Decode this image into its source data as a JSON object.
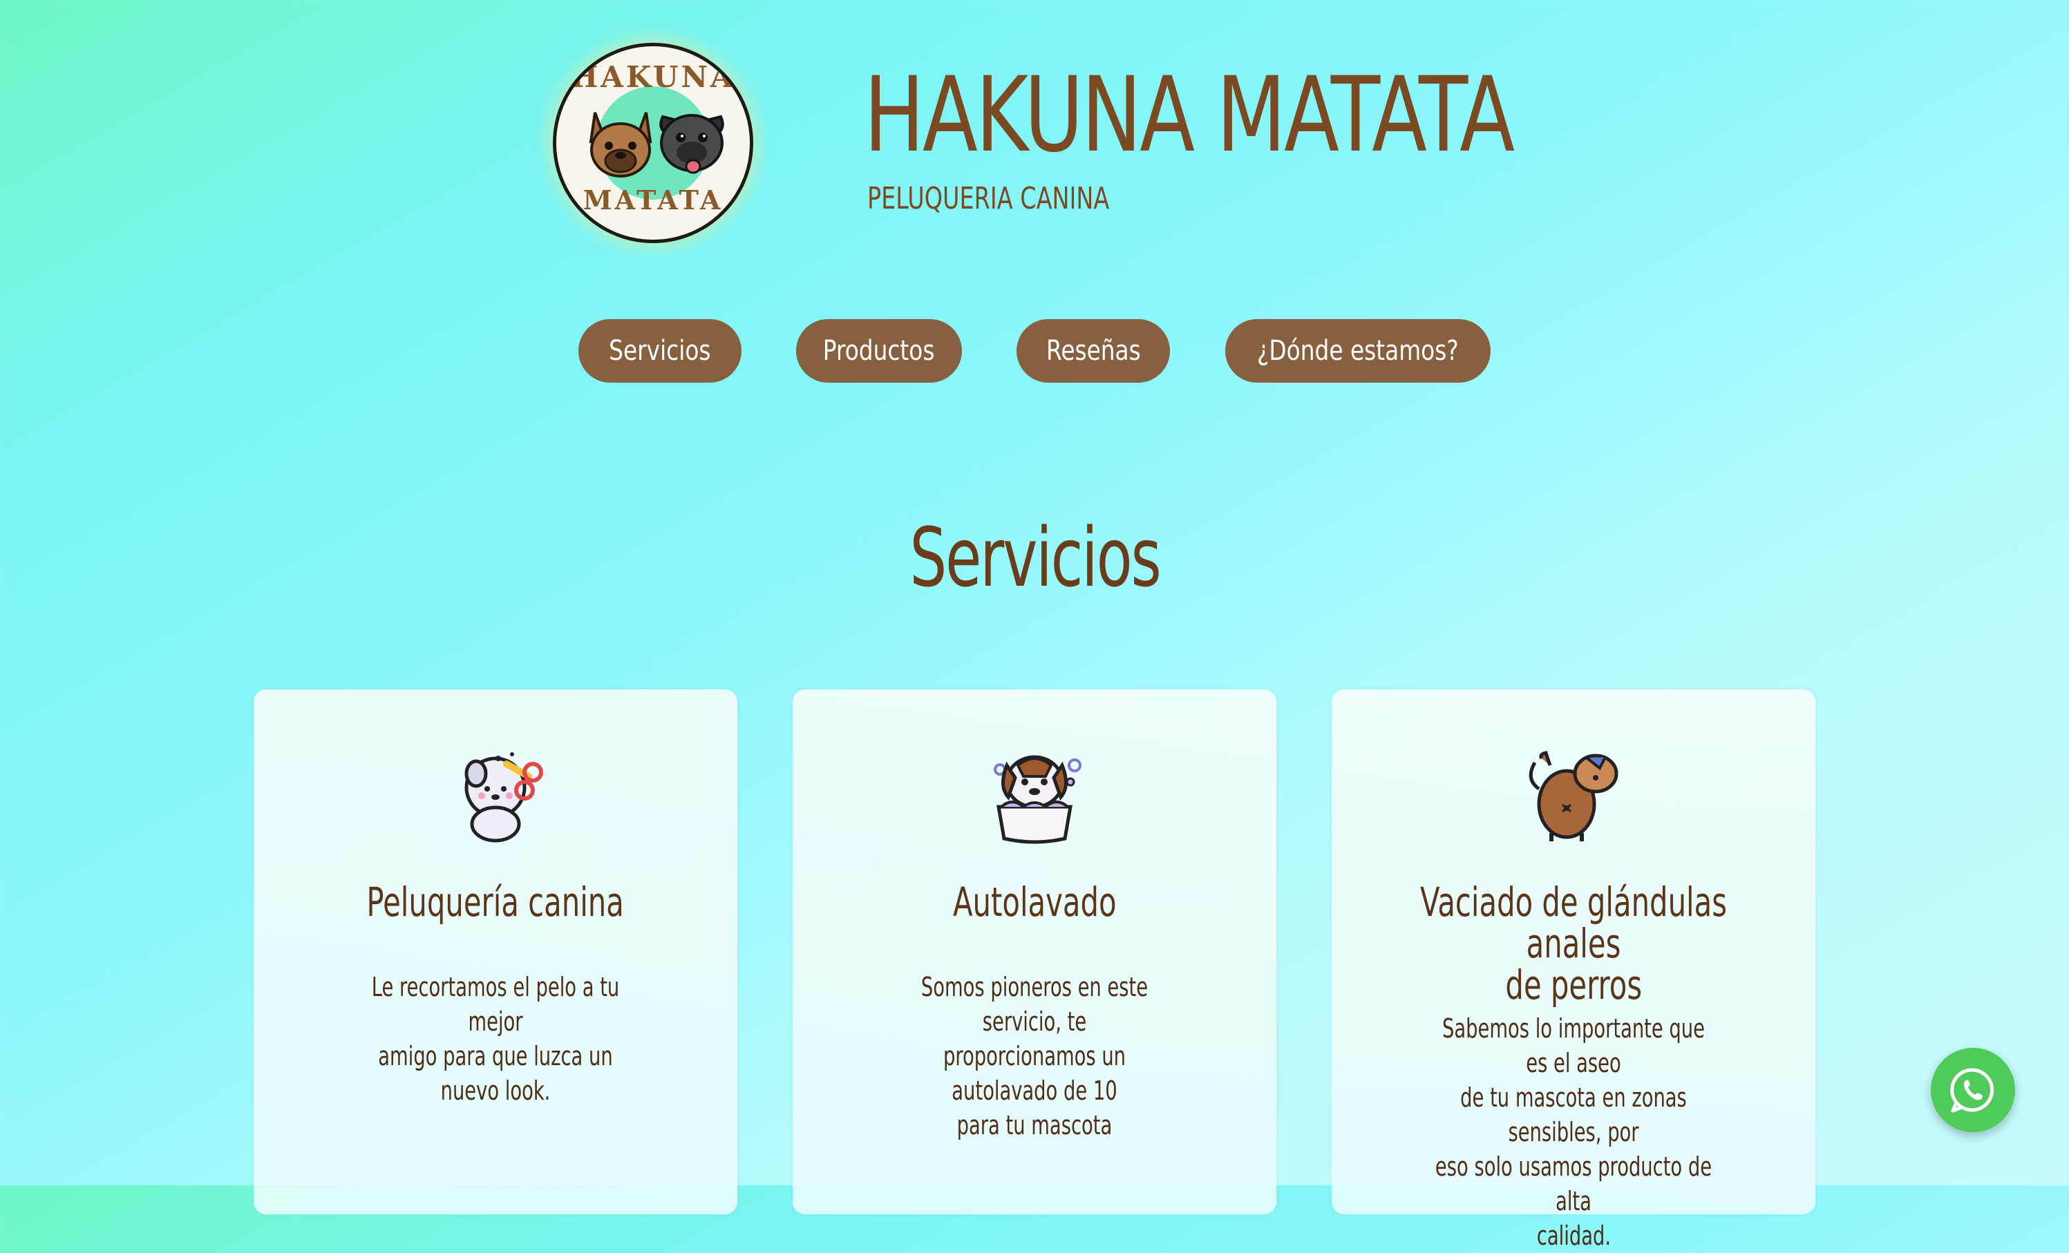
{
  "brand": {
    "logo_top_text": "HAKUNA",
    "logo_bottom_text": "MATATA",
    "title": "HAKUNA MATATA",
    "subtitle": "PELUQUERIA CANINA"
  },
  "nav": {
    "items": [
      {
        "label": "Servicios"
      },
      {
        "label": "Productos"
      },
      {
        "label": "Reseñas"
      },
      {
        "label": "¿Dónde estamos?"
      }
    ]
  },
  "services": {
    "heading": "Servicios",
    "cards": [
      {
        "icon": "dog-grooming-icon",
        "title": "Peluquería canina",
        "lines": [
          "Le recortamos el pelo a tu mejor",
          "amigo para que luzca un nuevo look."
        ]
      },
      {
        "icon": "dog-bath-icon",
        "title": "Autolavado",
        "lines": [
          "Somos pioneros en este servicio, te",
          "proporcionamos un autolavado de 10",
          "para tu mascota"
        ]
      },
      {
        "icon": "dog-rear-icon",
        "title_lines": [
          "Vaciado de glándulas anales",
          "de perros"
        ],
        "lines": [
          "Sabemos lo importante que es el aseo",
          "de tu mascota en zonas sensibles, por",
          "eso solo usamos producto de alta",
          "calidad."
        ]
      }
    ]
  },
  "whatsapp": {
    "icon": "whatsapp-icon"
  },
  "colors": {
    "brand_brown": "#7b4a22",
    "button_brown": "#87603f",
    "whatsapp_green": "#4ecb5b"
  }
}
